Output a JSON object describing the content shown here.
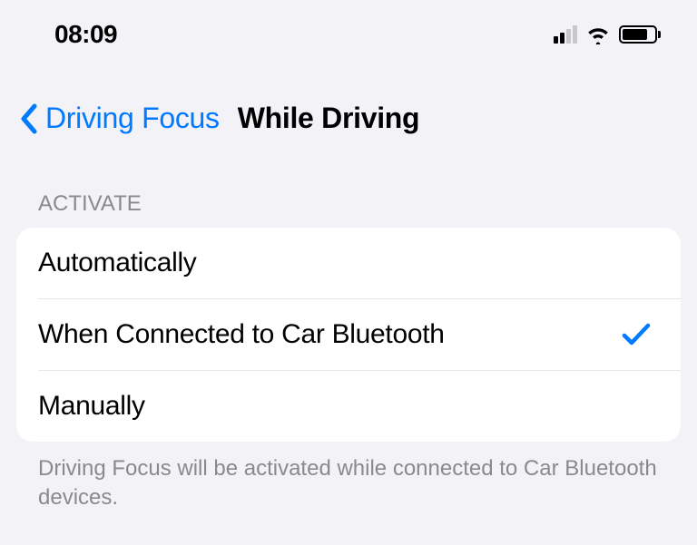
{
  "statusBar": {
    "time": "08:09"
  },
  "nav": {
    "backLabel": "Driving Focus",
    "title": "While Driving"
  },
  "section": {
    "header": "ACTIVATE",
    "footer": "Driving Focus will be activated while connected to Car Bluetooth devices."
  },
  "options": [
    {
      "label": "Automatically",
      "selected": false
    },
    {
      "label": "When Connected to Car Bluetooth",
      "selected": true
    },
    {
      "label": "Manually",
      "selected": false
    }
  ],
  "colors": {
    "accent": "#007aff"
  }
}
